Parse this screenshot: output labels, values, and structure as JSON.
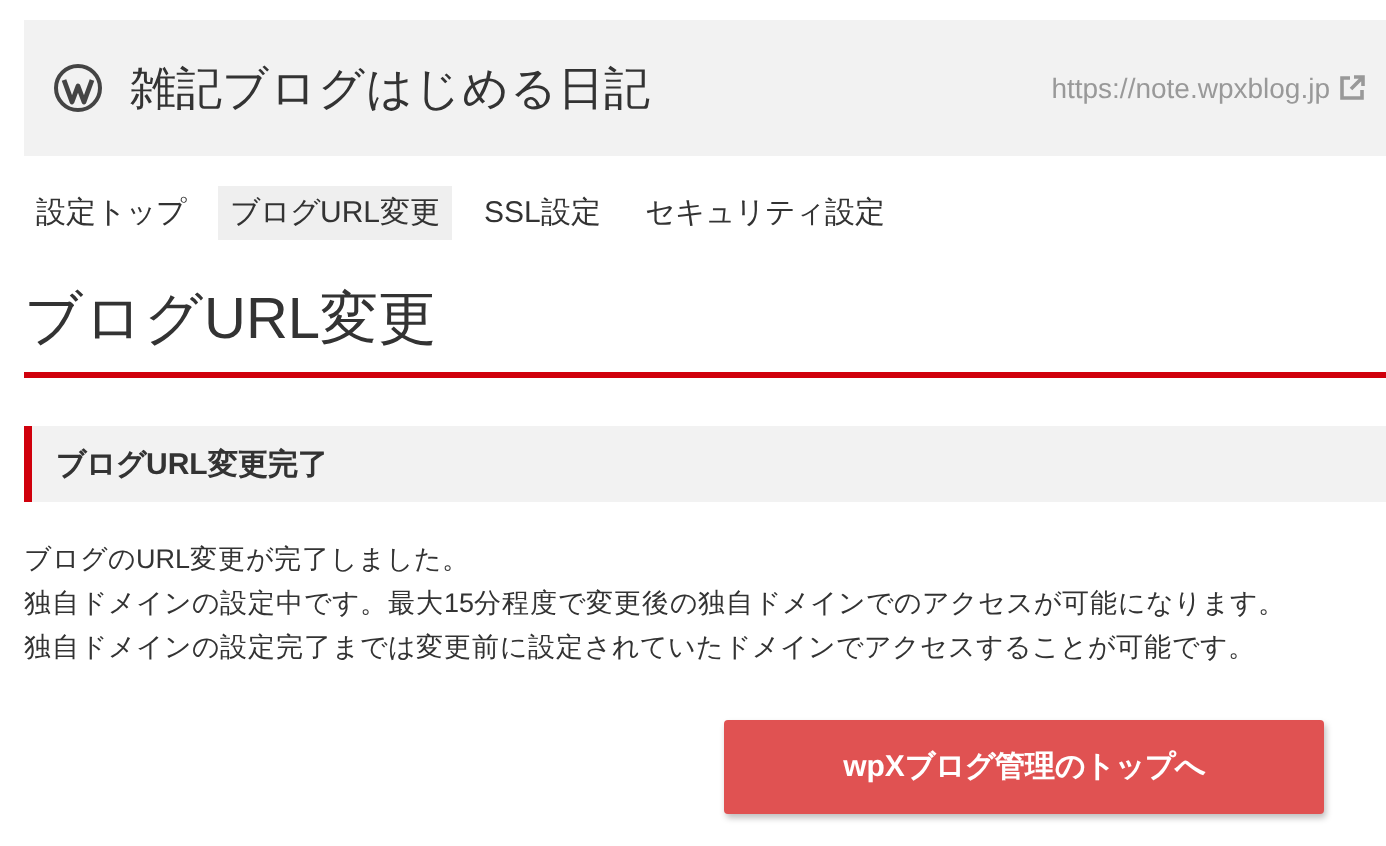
{
  "header": {
    "title": "雑記ブログはじめる日記",
    "url": "https://note.wpxblog.jp"
  },
  "tabs": [
    {
      "label": "設定トップ",
      "selected": false
    },
    {
      "label": "ブログURL変更",
      "selected": true
    },
    {
      "label": "SSL設定",
      "selected": false
    },
    {
      "label": "セキュリティ設定",
      "selected": false
    }
  ],
  "page_title": "ブログURL変更",
  "section": {
    "title": "ブログURL変更完了",
    "lines": [
      "ブログのURL変更が完了しました。",
      "独自ドメインの設定中です。最大15分程度で変更後の独自ドメインでのアクセスが可能になります。",
      "独自ドメインの設定完了までは変更前に設定されていたドメインでアクセスすることが可能です。"
    ]
  },
  "button": "wpXブログ管理のトップへ"
}
